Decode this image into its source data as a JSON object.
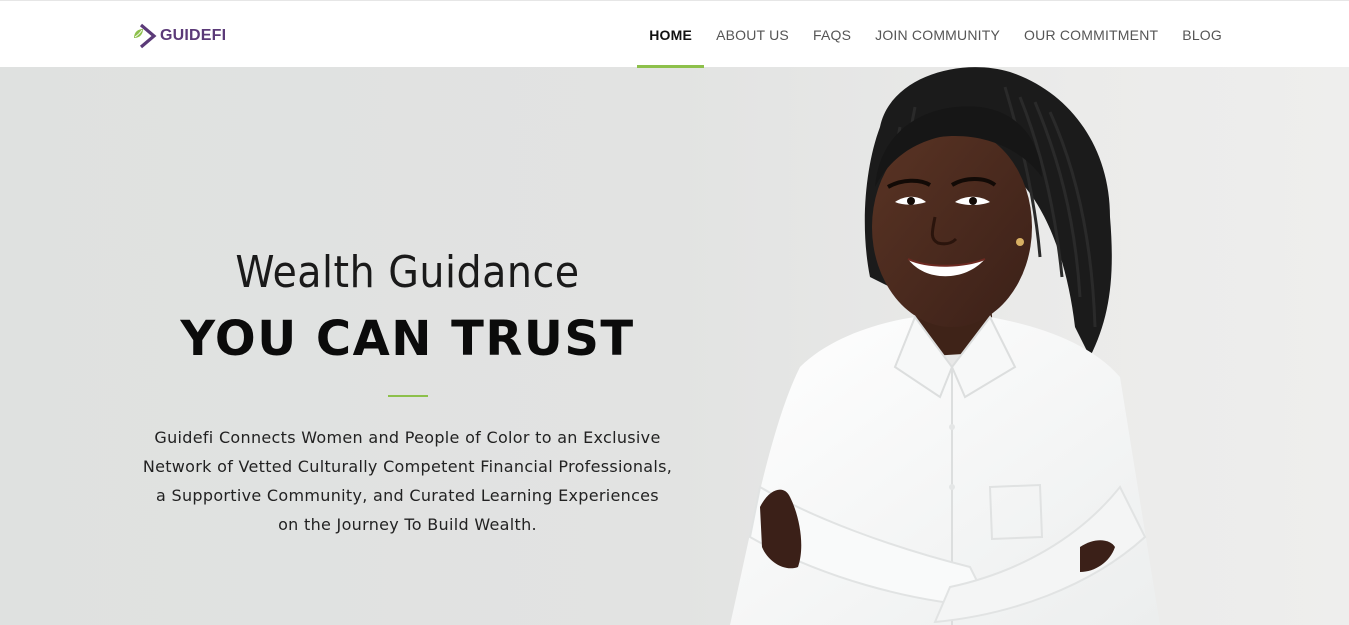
{
  "brand": {
    "name": "GUIDEFI",
    "logo_icon": "guidefi-chevron-leaf-logo",
    "primary_color": "#5b3a78",
    "accent_color": "#8dc04b"
  },
  "nav": {
    "items": [
      {
        "label": "HOME",
        "active": true
      },
      {
        "label": "ABOUT US",
        "active": false
      },
      {
        "label": "FAQS",
        "active": false
      },
      {
        "label": "JOIN COMMUNITY",
        "active": false
      },
      {
        "label": "OUR COMMITMENT",
        "active": false
      },
      {
        "label": "BLOG",
        "active": false
      }
    ]
  },
  "hero": {
    "title_light": "Wealth Guidance",
    "title_bold": "YOU CAN TRUST",
    "description_lines": [
      "Guidefi Connects Women and People of Color to an Exclusive",
      "Network of Vetted Culturally Competent Financial Professionals,",
      "a Supportive Community, and Curated Learning Experiences",
      "on the Journey To Build Wealth."
    ],
    "background_color": "#e0e2e1"
  }
}
